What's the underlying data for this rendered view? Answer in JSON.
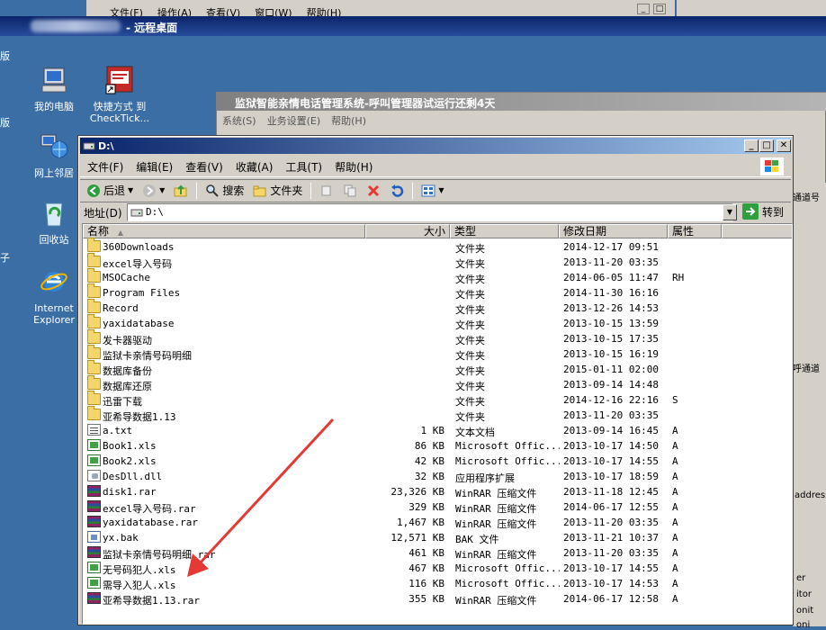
{
  "bg_window": {
    "menu": [
      "文件(F)",
      "操作(A)",
      "查看(V)",
      "窗口(W)",
      "帮助(H)"
    ]
  },
  "remote_desktop": {
    "title": "- 远程桌面"
  },
  "desktop": {
    "left_edge_chars": [
      "版",
      "版",
      "子"
    ],
    "icons": [
      {
        "label": "我的电脑",
        "icon": "my-computer-icon"
      },
      {
        "label": "快捷方式 到 CheckTick...",
        "icon": "shortcut-app-icon"
      },
      {
        "label": "网上邻居",
        "icon": "network-places-icon"
      },
      {
        "label": "回收站",
        "icon": "recycle-bin-icon"
      },
      {
        "label": "Internet Explorer",
        "icon": "ie-icon"
      }
    ]
  },
  "bg_app": {
    "title": "监狱智能亲情电话管理系统-呼叫管理器试运行还剩4天",
    "menu": [
      "系统(S)",
      "业务设置(E)",
      "帮助(H)"
    ],
    "right_texts": [
      "通道号",
      "呼通道",
      "addres",
      "er",
      "itor",
      "onit",
      "oni"
    ]
  },
  "explorer": {
    "title": "D:\\",
    "menu": [
      "文件(F)",
      "编辑(E)",
      "查看(V)",
      "收藏(A)",
      "工具(T)",
      "帮助(H)"
    ],
    "toolbar": {
      "back": "后退",
      "search": "搜索",
      "folders": "文件夹"
    },
    "address": {
      "label": "地址(D)",
      "value": "D:\\",
      "go": "转到"
    },
    "columns": {
      "name": "名称",
      "size": "大小",
      "type": "类型",
      "modified": "修改日期",
      "attr": "属性"
    },
    "files": [
      {
        "name": "360Downloads",
        "size": "",
        "type": "文件夹",
        "date": "2014-12-17 09:51",
        "attr": "",
        "kind": "folder"
      },
      {
        "name": "excel导入号码",
        "size": "",
        "type": "文件夹",
        "date": "2013-11-20 03:35",
        "attr": "",
        "kind": "folder"
      },
      {
        "name": "MSOCache",
        "size": "",
        "type": "文件夹",
        "date": "2014-06-05 11:47",
        "attr": "RH",
        "kind": "folder"
      },
      {
        "name": "Program Files",
        "size": "",
        "type": "文件夹",
        "date": "2014-11-30 16:16",
        "attr": "",
        "kind": "folder"
      },
      {
        "name": "Record",
        "size": "",
        "type": "文件夹",
        "date": "2013-12-26 14:53",
        "attr": "",
        "kind": "folder"
      },
      {
        "name": "yaxidatabase",
        "size": "",
        "type": "文件夹",
        "date": "2013-10-15 13:59",
        "attr": "",
        "kind": "folder"
      },
      {
        "name": "发卡器驱动",
        "size": "",
        "type": "文件夹",
        "date": "2013-10-15 17:35",
        "attr": "",
        "kind": "folder"
      },
      {
        "name": "监狱卡亲情号码明细",
        "size": "",
        "type": "文件夹",
        "date": "2013-10-15 16:19",
        "attr": "",
        "kind": "folder"
      },
      {
        "name": "数据库备份",
        "size": "",
        "type": "文件夹",
        "date": "2015-01-11 02:00",
        "attr": "",
        "kind": "folder"
      },
      {
        "name": "数据库还原",
        "size": "",
        "type": "文件夹",
        "date": "2013-09-14 14:48",
        "attr": "",
        "kind": "folder"
      },
      {
        "name": "迅雷下载",
        "size": "",
        "type": "文件夹",
        "date": "2014-12-16 22:16",
        "attr": "S",
        "kind": "folder"
      },
      {
        "name": "亚希导数据1.13",
        "size": "",
        "type": "文件夹",
        "date": "2013-11-20 03:35",
        "attr": "",
        "kind": "folder"
      },
      {
        "name": "a.txt",
        "size": "1 KB",
        "type": "文本文档",
        "date": "2013-09-14 16:45",
        "attr": "A",
        "kind": "txt"
      },
      {
        "name": "Book1.xls",
        "size": "86 KB",
        "type": "Microsoft Offic...",
        "date": "2013-10-17 14:50",
        "attr": "A",
        "kind": "xls"
      },
      {
        "name": "Book2.xls",
        "size": "42 KB",
        "type": "Microsoft Offic...",
        "date": "2013-10-17 14:55",
        "attr": "A",
        "kind": "xls"
      },
      {
        "name": "DesDll.dll",
        "size": "32 KB",
        "type": "应用程序扩展",
        "date": "2013-10-17 18:59",
        "attr": "A",
        "kind": "dll"
      },
      {
        "name": "disk1.rar",
        "size": "23,326 KB",
        "type": "WinRAR 压缩文件",
        "date": "2013-11-18 12:45",
        "attr": "A",
        "kind": "rar"
      },
      {
        "name": "excel导入号码.rar",
        "size": "329 KB",
        "type": "WinRAR 压缩文件",
        "date": "2014-06-17 12:55",
        "attr": "A",
        "kind": "rar"
      },
      {
        "name": "yaxidatabase.rar",
        "size": "1,467 KB",
        "type": "WinRAR 压缩文件",
        "date": "2013-11-20 03:35",
        "attr": "A",
        "kind": "rar"
      },
      {
        "name": "yx.bak",
        "size": "12,571 KB",
        "type": "BAK 文件",
        "date": "2013-11-21 10:37",
        "attr": "A",
        "kind": "bak"
      },
      {
        "name": "监狱卡亲情号码明细.rar",
        "size": "461 KB",
        "type": "WinRAR 压缩文件",
        "date": "2013-11-20 03:35",
        "attr": "A",
        "kind": "rar"
      },
      {
        "name": "无号码犯人.xls",
        "size": "467 KB",
        "type": "Microsoft Offic...",
        "date": "2013-10-17 14:55",
        "attr": "A",
        "kind": "xls"
      },
      {
        "name": "需导入犯人.xls",
        "size": "116 KB",
        "type": "Microsoft Offic...",
        "date": "2013-10-17 14:53",
        "attr": "A",
        "kind": "xls"
      },
      {
        "name": "亚希导数据1.13.rar",
        "size": "355 KB",
        "type": "WinRAR 压缩文件",
        "date": "2014-06-17 12:58",
        "attr": "A",
        "kind": "rar"
      }
    ]
  },
  "annotation": {
    "color": "#e53935"
  }
}
